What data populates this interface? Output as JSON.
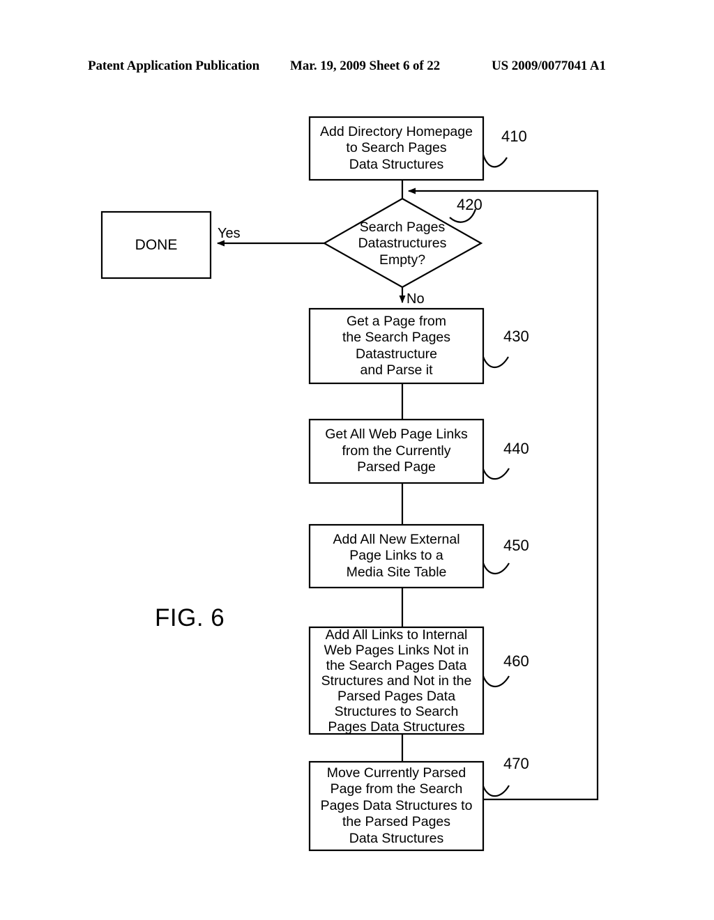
{
  "header": {
    "left": "Patent Application Publication",
    "middle": "Mar. 19, 2009  Sheet 6 of 22",
    "right": "US 2009/0077041 A1"
  },
  "figure": {
    "label": "FIG. 6",
    "ink_color": "#000000",
    "background_color": "#ffffff"
  },
  "flowchart": {
    "terminal": {
      "id": "done",
      "label": "DONE"
    },
    "decision": {
      "ref": "420",
      "text": "Search Pages\nDatastructures\nEmpty?",
      "yes_label": "Yes",
      "no_label": "No"
    },
    "steps": [
      {
        "ref": "410",
        "text": "Add Directory Homepage\nto Search Pages\nData Structures"
      },
      {
        "ref": "430",
        "text": "Get a Page from\nthe Search Pages\nDatastructure\nand Parse it"
      },
      {
        "ref": "440",
        "text": "Get All Web Page Links\nfrom the Currently\nParsed Page"
      },
      {
        "ref": "450",
        "text": "Add All New External\nPage Links to a\nMedia Site Table"
      },
      {
        "ref": "460",
        "text": "Add All Links to Internal\nWeb Pages Links Not in\nthe Search Pages Data\nStructures and Not in the\nParsed Pages Data\nStructures to Search\nPages Data Structures"
      },
      {
        "ref": "470",
        "text": "Move Currently Parsed\nPage from the Search\nPages Data Structures to\nthe Parsed Pages\nData Structures"
      }
    ]
  }
}
